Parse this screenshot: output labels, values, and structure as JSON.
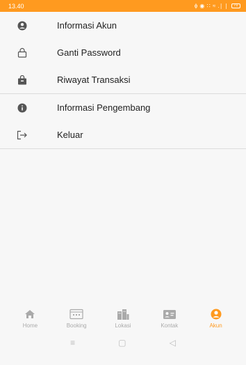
{
  "status_bar": {
    "time": "13.40",
    "indicators": "ϕ ◉ ∷ ≈ .∣ ∣",
    "battery": "70"
  },
  "menu": {
    "items": [
      {
        "label": "Informasi Akun",
        "icon": "user-circle-icon"
      },
      {
        "label": "Ganti Password",
        "icon": "lock-icon"
      },
      {
        "label": "Riwayat Transaksi",
        "icon": "shopping-bag-icon"
      },
      {
        "label": "Informasi Pengembang",
        "icon": "info-icon"
      },
      {
        "label": "Keluar",
        "icon": "logout-icon"
      }
    ]
  },
  "bottom_nav": {
    "items": [
      {
        "label": "Home",
        "icon": "home-icon",
        "active": false
      },
      {
        "label": "Booking",
        "icon": "calendar-icon",
        "active": false
      },
      {
        "label": "Lokasi",
        "icon": "buildings-icon",
        "active": false
      },
      {
        "label": "Kontak",
        "icon": "contact-card-icon",
        "active": false
      },
      {
        "label": "Akun",
        "icon": "account-icon",
        "active": true
      }
    ],
    "active_color": "#ff9a1f",
    "inactive_color": "#aaaaaa"
  },
  "system_nav": {
    "recent": "≡",
    "home": "▢",
    "back": "◁"
  },
  "colors": {
    "accent": "#ff9a1f"
  }
}
